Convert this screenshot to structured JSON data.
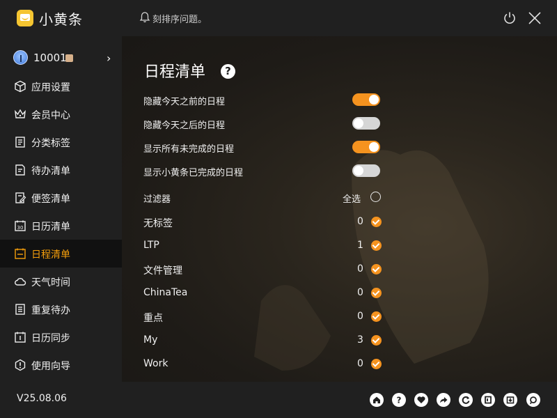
{
  "app": {
    "title": "小黄条",
    "notice": "刻排序问题。",
    "version": "V25.08.06"
  },
  "user": {
    "id": "10001"
  },
  "sidebar": {
    "items": [
      {
        "label": "应用设置",
        "icon": "cube-icon"
      },
      {
        "label": "会员中心",
        "icon": "crown-icon"
      },
      {
        "label": "分类标签",
        "icon": "list-icon"
      },
      {
        "label": "待办清单",
        "icon": "todo-icon"
      },
      {
        "label": "便签清单",
        "icon": "note-icon"
      },
      {
        "label": "日历清单",
        "icon": "calendar-30-icon"
      },
      {
        "label": "日程清单",
        "icon": "schedule-icon",
        "active": true
      },
      {
        "label": "天气时间",
        "icon": "cloud-icon"
      },
      {
        "label": "重复待办",
        "icon": "repeat-icon"
      },
      {
        "label": "日历同步",
        "icon": "calendar-sync-icon"
      },
      {
        "label": "使用向导",
        "icon": "guide-icon"
      }
    ]
  },
  "main": {
    "title": "日程清单",
    "settings": [
      {
        "label": "隐藏今天之前的日程",
        "on": true
      },
      {
        "label": "隐藏今天之后的日程",
        "on": false
      },
      {
        "label": "显示所有未完成的日程",
        "on": true
      },
      {
        "label": "显示小黄条已完成的日程",
        "on": false
      }
    ],
    "filter": {
      "label": "过滤器",
      "select_all": "全选",
      "tags": [
        {
          "name": "无标签",
          "count": "0",
          "checked": true
        },
        {
          "name": "LTP",
          "count": "1",
          "checked": true
        },
        {
          "name": "文件管理",
          "count": "0",
          "checked": true
        },
        {
          "name": "ChinaTea",
          "count": "0",
          "checked": true
        },
        {
          "name": "重点",
          "count": "0",
          "checked": true
        },
        {
          "name": "My",
          "count": "3",
          "checked": true
        },
        {
          "name": "Work",
          "count": "0",
          "checked": true
        }
      ]
    }
  },
  "colors": {
    "accent": "#f59e0b",
    "toggle_on": "#f5931f",
    "toggle_off": "#d6d6d6"
  },
  "footer": {
    "icons": [
      "home-icon",
      "help-icon",
      "heart-icon",
      "share-icon",
      "refresh-icon",
      "export-icon",
      "download-icon",
      "support-icon"
    ]
  }
}
